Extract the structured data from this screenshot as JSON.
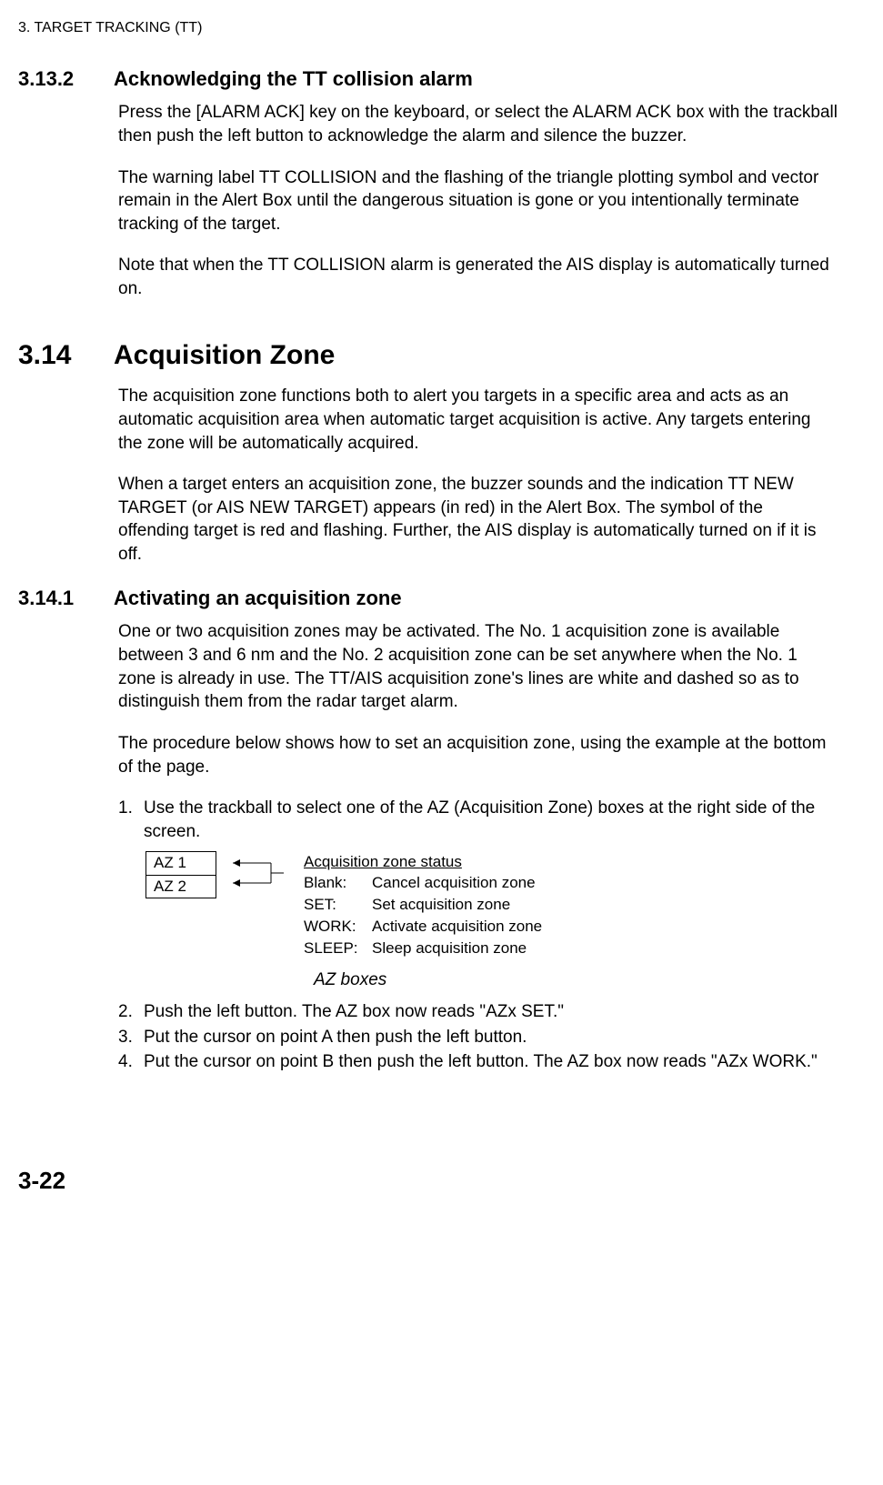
{
  "header": "3. TARGET TRACKING (TT)",
  "sec_3_13_2": {
    "num": "3.13.2",
    "title": "Acknowledging the TT collision alarm",
    "p1": "Press the [ALARM ACK] key on the keyboard, or select the ALARM ACK box with the trackball then push the left button to acknowledge the alarm and silence the buzzer.",
    "p2": "The warning label TT COLLISION and the flashing of the triangle plotting symbol and vector remain in the Alert Box until the dangerous situation is gone or you intentionally terminate tracking of the target.",
    "p3": "Note that when the TT COLLISION alarm is generated the AIS display is automatically turned on."
  },
  "sec_3_14": {
    "num": "3.14",
    "title": "Acquisition Zone",
    "p1": "The acquisition zone functions both to alert you targets in a specific area and acts as an automatic acquisition area when automatic target acquisition is active. Any targets entering the zone will be automatically acquired.",
    "p2": "When a target enters an acquisition zone, the buzzer sounds and the indication TT NEW TARGET (or AIS NEW TARGET) appears (in red) in the Alert Box. The symbol of the offending target is red and flashing. Further, the AIS display is automatically turned on if it is off."
  },
  "sec_3_14_1": {
    "num": "3.14.1",
    "title": "Activating an acquisition zone",
    "p1": "One or two acquisition zones may be activated. The No. 1 acquisition zone is available between 3 and 6 nm and the No. 2 acquisition zone can be set anywhere when the No. 1 zone is already in use. The TT/AIS acquisition zone's lines are white and dashed so as to distinguish them from the radar target alarm.",
    "p2": "The procedure below shows how to set an acquisition zone, using the example at the bottom of the page.",
    "steps": [
      {
        "n": "1.",
        "t": "Use the trackball to select one of the AZ (Acquisition Zone) boxes at the right side of the screen."
      },
      {
        "n": "2.",
        "t": "Push the left button. The AZ box now reads \"AZx SET.\""
      },
      {
        "n": "3.",
        "t": "Put the cursor on point A then push the left button."
      },
      {
        "n": "4.",
        "t": "Put the cursor on point B then push the left button. The AZ box now reads \"AZx WORK.\""
      }
    ]
  },
  "figure": {
    "az1": "AZ 1",
    "az2": "AZ 2",
    "status_title": "Acquisition zone status",
    "rows": [
      {
        "label": "Blank:",
        "desc": "Cancel acquisition zone"
      },
      {
        "label": "SET:",
        "desc": "Set acquisition zone"
      },
      {
        "label": "WORK:",
        "desc": "Activate acquisition zone"
      },
      {
        "label": "SLEEP:",
        "desc": "Sleep acquisition zone"
      }
    ],
    "caption": "AZ boxes"
  },
  "page_number": "3-22"
}
